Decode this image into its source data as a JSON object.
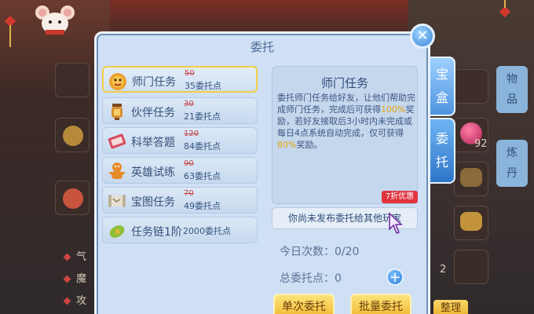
{
  "dialog": {
    "title": "委托",
    "close_label": "✕"
  },
  "tasks": [
    {
      "name": "师门任务",
      "old": "50",
      "new": "35委托点",
      "selected": true
    },
    {
      "name": "伙伴任务",
      "old": "30",
      "new": "21委托点"
    },
    {
      "name": "科举答题",
      "old": "120",
      "new": "84委托点"
    },
    {
      "name": "英雄试练",
      "old": "90",
      "new": "63委托点"
    },
    {
      "name": "宝图任务",
      "old": "70",
      "new": "49委托点"
    },
    {
      "name": "任务链1阶",
      "single": "2000委托点"
    }
  ],
  "detail": {
    "title": "师门任务",
    "text_a": "委托师门任务给好友，让他们帮助完成师门任务，完成后可获得",
    "pct_a": "100%",
    "text_b": "奖励，若好友接取后3小时内未完成或每日4点系统自动完成，仅可获得",
    "pct_b": "80%",
    "text_c": "奖励。",
    "badge": "7折优惠"
  },
  "notice": "你尚未发布委托给其他玩家",
  "stats": {
    "today_label": "今日次数：",
    "today_value": "0/20",
    "points_label": "总委托点：",
    "points_value": "0",
    "plus": "+"
  },
  "buttons": {
    "single": "单次委托",
    "batch": "批量委托",
    "sort": "整理"
  },
  "side_tabs": [
    {
      "label_1": "宝",
      "label_2": "盒"
    },
    {
      "label_1": "委",
      "label_2": "托"
    }
  ],
  "right_tabs": [
    {
      "label_1": "物",
      "label_2": "品"
    },
    {
      "label_1": "炼",
      "label_2": "丹"
    }
  ],
  "bg_left_labels": [
    "气",
    "魔",
    "攻"
  ],
  "bg_numbers": {
    "a": "92",
    "b": "2"
  },
  "colors": {
    "highlight": "#e6a40a",
    "strike": "#c5484a",
    "badge": "#e0343f",
    "button": "#f0b62d",
    "accent": "#3a86d8"
  }
}
